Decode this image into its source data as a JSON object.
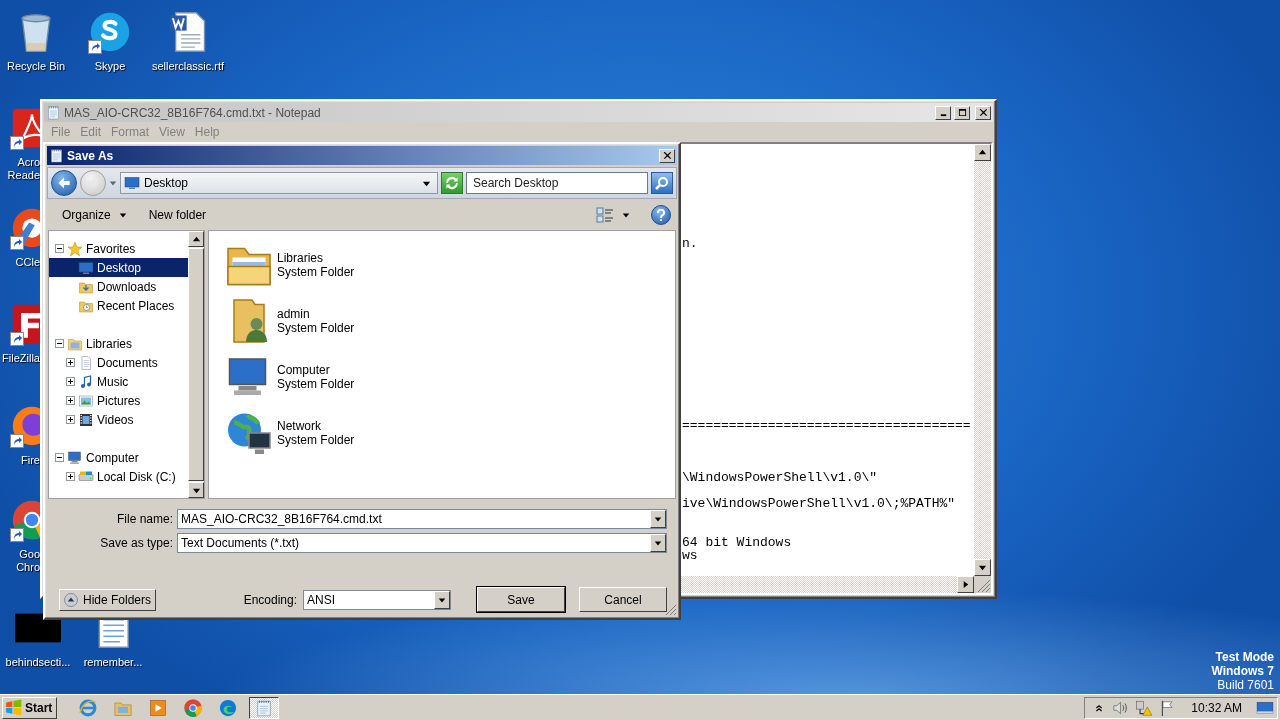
{
  "desktop_icons": [
    {
      "kind": "recycle-bin",
      "label": "Recycle Bin",
      "shortcut": false
    },
    {
      "kind": "skype",
      "label": "Skype",
      "shortcut": true
    },
    {
      "kind": "word-document",
      "label": "sellerclassic.rtf",
      "shortcut": false
    },
    {
      "kind": "acrobat",
      "label": "Acro Reade",
      "shortcut": true
    },
    {
      "kind": "ccleaner",
      "label": "CCle",
      "shortcut": true
    },
    {
      "kind": "filezilla",
      "label": "FileZilla",
      "shortcut": true
    },
    {
      "kind": "firefox",
      "label": "Fire",
      "shortcut": true
    },
    {
      "kind": "chrome",
      "label": "Goo Chro",
      "shortcut": true
    },
    {
      "kind": "black-file",
      "label": "behindsecti...",
      "shortcut": false
    },
    {
      "kind": "text-document",
      "label": "remember...",
      "shortcut": false
    }
  ],
  "system_notice": [
    {
      "text": "Test Mode",
      "bold": true
    },
    {
      "text": "Windows 7",
      "bold": true
    },
    {
      "text": "Build 7601",
      "bold": false
    }
  ],
  "notepad": {
    "title": "MAS_AIO-CRC32_8B16F764.cmd.txt - Notepad",
    "menu": [
      "File",
      "Edit",
      "Format",
      "View",
      "Help"
    ],
    "lines": [
      "n.",
      "=====================================",
      "\\WindowsPowerShell\\v1.0\\\"",
      "ive\\WindowsPowerShell\\v1.0\\;%PATH%\"",
      "64 bit Windows",
      "ws"
    ]
  },
  "save_dialog": {
    "title": "Save As",
    "address": "Desktop",
    "search": {
      "placeholder": "Search Desktop"
    },
    "toolbar": [
      {
        "label": "Organize",
        "menu": true
      },
      {
        "label": "New folder",
        "menu": false
      }
    ],
    "nav_tree": [
      {
        "label": "Favorites",
        "kind": "star",
        "expanded": true,
        "selected": false,
        "children": [
          {
            "label": "Desktop",
            "kind": "desktop",
            "selected": true
          },
          {
            "label": "Downloads",
            "kind": "downloads",
            "selected": false
          },
          {
            "label": "Recent Places",
            "kind": "recent",
            "selected": false
          }
        ]
      },
      {
        "label": "Libraries",
        "kind": "library",
        "expanded": true,
        "selected": false,
        "children": [
          {
            "label": "Documents",
            "kind": "documents",
            "expanded": false,
            "selected": false
          },
          {
            "label": "Music",
            "kind": "music",
            "expanded": false,
            "selected": false
          },
          {
            "label": "Pictures",
            "kind": "pictures",
            "expanded": false,
            "selected": false
          },
          {
            "label": "Videos",
            "kind": "videos",
            "expanded": false,
            "selected": false
          }
        ]
      },
      {
        "label": "Computer",
        "kind": "computer",
        "expanded": true,
        "selected": false,
        "children": [
          {
            "label": "Local Disk (C:)",
            "kind": "disk",
            "expanded": false,
            "selected": false
          }
        ]
      }
    ],
    "files": [
      {
        "name": "Libraries",
        "type": "System Folder",
        "kind": "libraries"
      },
      {
        "name": "admin",
        "type": "System Folder",
        "kind": "user"
      },
      {
        "name": "Computer",
        "type": "System Folder",
        "kind": "computer"
      },
      {
        "name": "Network",
        "type": "System Folder",
        "kind": "network"
      }
    ],
    "file_name": {
      "label": "File name:",
      "value": "MAS_AIO-CRC32_8B16F764.cmd.txt"
    },
    "save_as_type": {
      "label": "Save as type:",
      "value": "Text Documents (*.txt)"
    },
    "hide_folders": "Hide Folders",
    "encoding": {
      "label": "Encoding:",
      "value": "ANSI"
    },
    "buttons": [
      {
        "label": "Save",
        "default": true
      },
      {
        "label": "Cancel",
        "default": false
      }
    ]
  },
  "taskbar": {
    "start": "Start",
    "pinned": [
      {
        "kind": "ie"
      },
      {
        "kind": "explorer"
      },
      {
        "kind": "media"
      },
      {
        "kind": "chrome"
      },
      {
        "kind": "edge"
      }
    ],
    "tasks": [
      {
        "kind": "notepad",
        "active": true
      }
    ],
    "clock": "10:32 AM"
  }
}
